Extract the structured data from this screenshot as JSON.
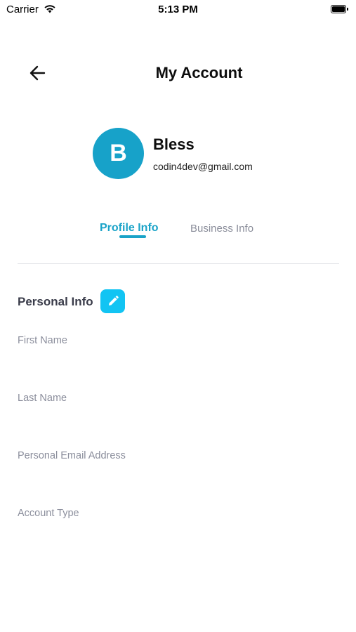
{
  "status_bar": {
    "carrier": "Carrier",
    "time": "5:13 PM"
  },
  "header": {
    "title": "My Account",
    "back_icon": "arrow-left-icon"
  },
  "profile": {
    "initial": "B",
    "name": "Bless",
    "email": "codin4dev@gmail.com",
    "avatar_color": "#17a2c9"
  },
  "tabs": [
    {
      "label": "Profile Info",
      "active": true
    },
    {
      "label": "Business Info",
      "active": false
    }
  ],
  "section": {
    "title": "Personal Info",
    "edit_icon": "pencil-icon",
    "edit_color": "#12c4f3"
  },
  "fields": [
    {
      "label": "First Name"
    },
    {
      "label": "Last Name"
    },
    {
      "label": "Personal Email Address"
    },
    {
      "label": "Account Type"
    }
  ],
  "colors": {
    "accent": "#1aa3c8",
    "muted": "#8b8e9c"
  }
}
